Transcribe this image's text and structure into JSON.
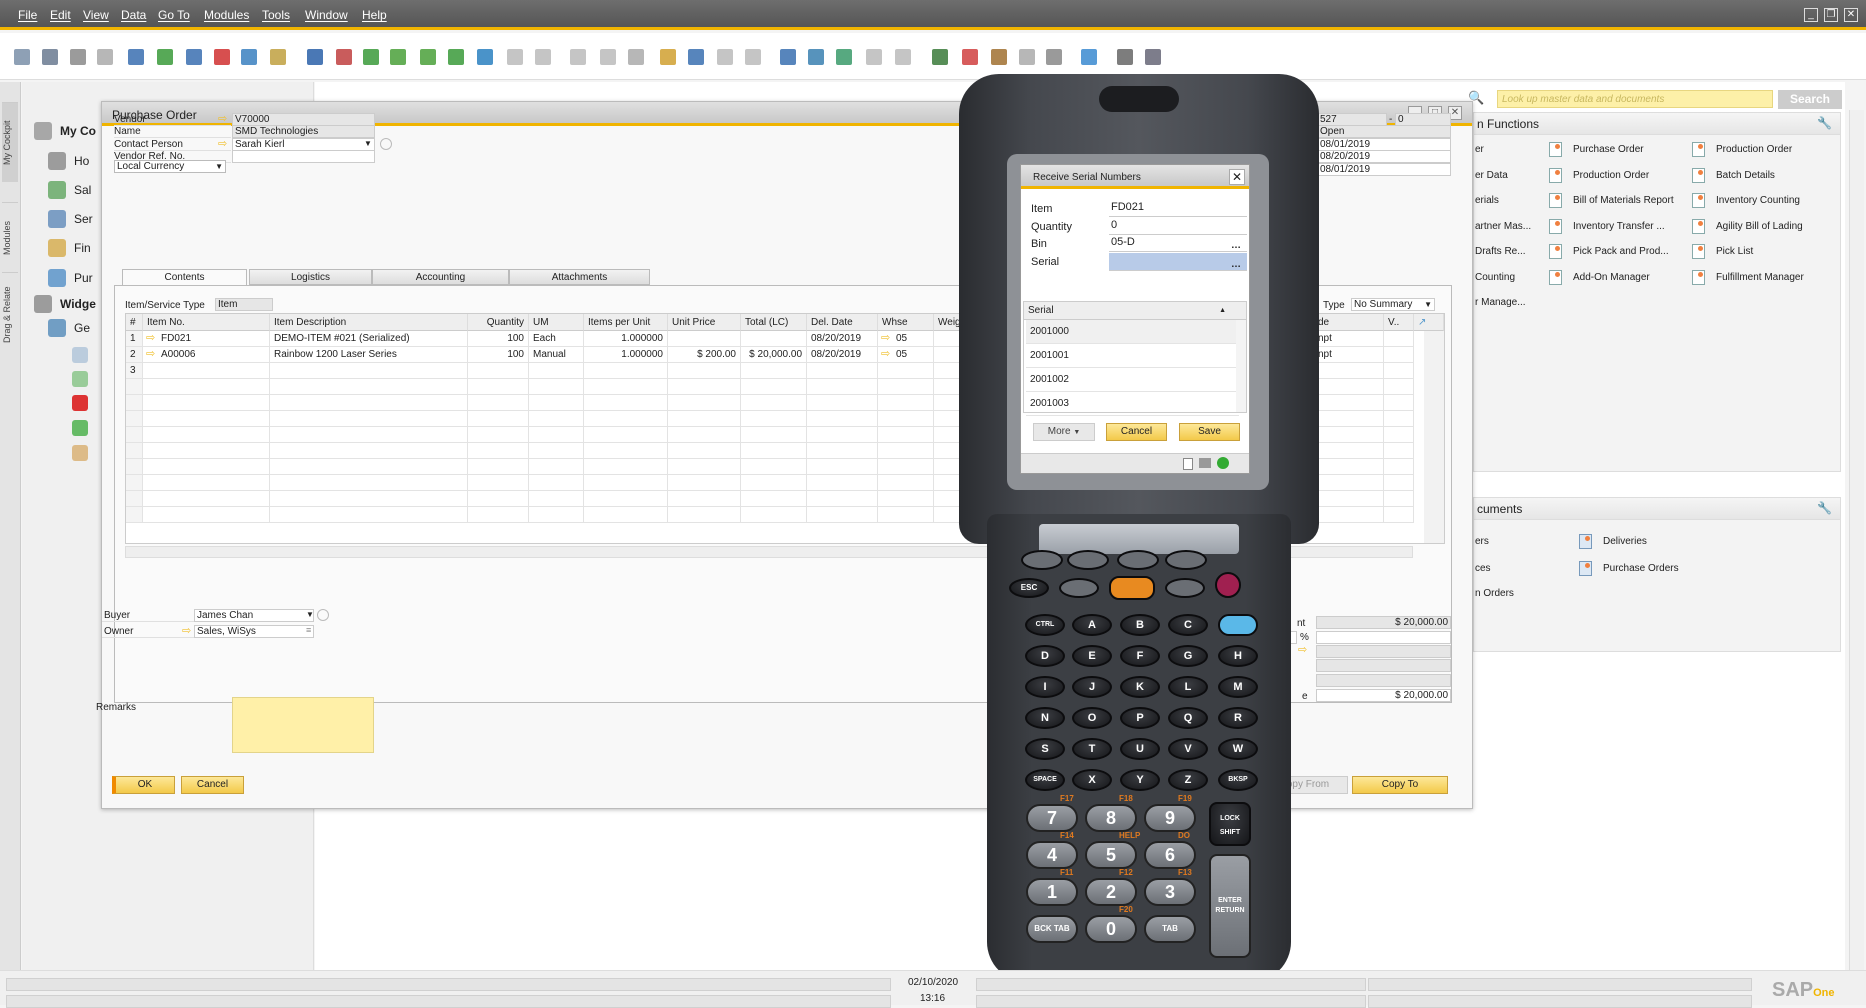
{
  "menu": [
    "File",
    "Edit",
    "View",
    "Data",
    "Go To",
    "Modules",
    "Tools",
    "Window",
    "Help"
  ],
  "toolbar_icons": [
    "preview-icon",
    "print-icon",
    "email-icon",
    "sms-icon",
    "fax-icon",
    "excel-icon",
    "word-icon",
    "pdf-icon",
    "launch-icon",
    "lock-layout-icon",
    "find-icon",
    "add-icon",
    "first-record-icon",
    "previous-record-icon",
    "next-record-icon",
    "last-record-icon",
    "refresh-icon",
    "filter-icon",
    "sort-icon",
    "base-document-icon",
    "target-document-icon",
    "copy-icon",
    "user-icon",
    "chart-icon",
    "settings-icon",
    "query-icon",
    "edit-icon",
    "new-document-icon",
    "approve-icon",
    "message-icon",
    "alerts-icon",
    "calendar-icon",
    "mail-icon",
    "reports-icon",
    "organization-icon",
    "people-icon",
    "help-icon",
    "calculator-icon",
    "form-icon"
  ],
  "left_tabs": [
    "My Cockpit",
    "Modules",
    "Drag & Relate"
  ],
  "cockpit": {
    "items": [
      "My Co",
      "Ho",
      "Sal",
      "Ser",
      "Fin",
      "Pur",
      "Widge",
      "Ge"
    ]
  },
  "search": {
    "placeholder": "Look up master data and documents",
    "button": "Search"
  },
  "po": {
    "title": "Purchase Order",
    "fields": [
      {
        "label": "Vendor",
        "value": "V70000"
      },
      {
        "label": "Name",
        "value": "SMD Technologies"
      },
      {
        "label": "Contact Person",
        "value": "Sarah Kierl"
      },
      {
        "label": "Vendor Ref. No.",
        "value": ""
      }
    ],
    "currency": "Local Currency",
    "right_fields": [
      "527",
      "0",
      "Open",
      "08/01/2019",
      "08/20/2019",
      "08/01/2019"
    ],
    "tabs": [
      "Contents",
      "Logistics",
      "Accounting",
      "Attachments"
    ],
    "item_type_label": "Item/Service Type",
    "item_type_value": "Item",
    "summary_label": "Type",
    "summary_value": "No Summary",
    "columns": [
      "#",
      "Item No.",
      "Item Description",
      "Quantity",
      "UM",
      "Items per Unit",
      "Unit Price",
      "Total (LC)",
      "Del. Date",
      "Whse",
      "Weight"
    ],
    "right_columns": [
      "de",
      "V.."
    ],
    "rows": [
      [
        "1",
        "FD021",
        "DEMO-ITEM #021 (Serialized)",
        "100",
        "Each",
        "1.000000",
        "",
        "",
        "08/20/2019",
        "05",
        "",
        "npt"
      ],
      [
        "2",
        "A00006",
        "Rainbow 1200 Laser Series",
        "100",
        "Manual",
        "1.000000",
        "$ 200.00",
        "$ 20,000.00",
        "08/20/2019",
        "05",
        "",
        "npt"
      ],
      [
        "3",
        "",
        "",
        "",
        "",
        "",
        "",
        "",
        "",
        "",
        "",
        ""
      ]
    ],
    "buyer_label": "Buyer",
    "buyer": "James Chan",
    "owner_label": "Owner",
    "owner": "Sales, WiSys",
    "remarks_label": "Remarks",
    "totals_label_first": "nt",
    "totals_label_last": "e",
    "percent": "%",
    "total_before": "$ 20,000.00",
    "total": "$ 20,000.00",
    "ok": "OK",
    "cancel": "Cancel",
    "copy_from": "opy From",
    "copy_to": "Copy To"
  },
  "functions": {
    "title": "n Functions",
    "col0": [
      "er",
      "er Data",
      "erials",
      "artner Mas...",
      "Drafts Re...",
      "Counting",
      "r Manage..."
    ],
    "col1": [
      "Purchase Order",
      "Production Order",
      "Bill of Materials Report",
      "Inventory Transfer ...",
      "Pick Pack and Prod...",
      "Add-On Manager"
    ],
    "col2": [
      "Production Order",
      "Batch Details",
      "Inventory Counting",
      "Agility Bill of Lading",
      "Pick List",
      "Fulfillment Manager"
    ]
  },
  "documents": {
    "title": "cuments",
    "col0": [
      "ers",
      "ces",
      "n Orders"
    ],
    "col1": [
      "Deliveries",
      "Purchase Orders"
    ]
  },
  "status": {
    "date": "02/10/2020",
    "time": "13:16",
    "logo": "SAP Business One"
  },
  "device_dialog": {
    "title": "Receive Serial Numbers",
    "item_label": "Item",
    "item": "FD021",
    "quantity_label": "Quantity",
    "quantity": "0",
    "bin_label": "Bin",
    "bin": "05-D",
    "serial_label": "Serial",
    "serial": "",
    "list_header": "Serial",
    "serials": [
      "2001000",
      "2001001",
      "2001002",
      "2001003"
    ],
    "more": "More",
    "cancel": "Cancel",
    "save": "Save"
  },
  "keypad": {
    "letters": [
      [
        "CTRL",
        "A",
        "B",
        "C",
        ""
      ],
      [
        "D",
        "E",
        "F",
        "G",
        "H"
      ],
      [
        "I",
        "J",
        "K",
        "L",
        "M"
      ],
      [
        "N",
        "O",
        "P",
        "Q",
        "R"
      ],
      [
        "S",
        "T",
        "U",
        "V",
        "W"
      ],
      [
        "SPACE",
        "X",
        "Y",
        "Z",
        "BKSP"
      ]
    ],
    "numbers": [
      [
        "7",
        "8",
        "9"
      ],
      [
        "4",
        "5",
        "6"
      ],
      [
        "1",
        "2",
        "3"
      ],
      [
        "BCK TAB",
        "0",
        "TAB"
      ]
    ],
    "fn": [
      [
        "F17",
        "F18",
        "F19"
      ],
      [
        "F14",
        "HELP",
        "DO"
      ],
      [
        "F11",
        "F12",
        "F13"
      ],
      [
        "",
        "F20",
        ""
      ]
    ],
    "esc": "ESC",
    "lock_shift": "LOCK SHIFT",
    "enter": "ENTER RETURN"
  },
  "colors": {
    "accent": "#f0b400",
    "button": "#f3c94a",
    "remarks": "#fff0a8"
  }
}
